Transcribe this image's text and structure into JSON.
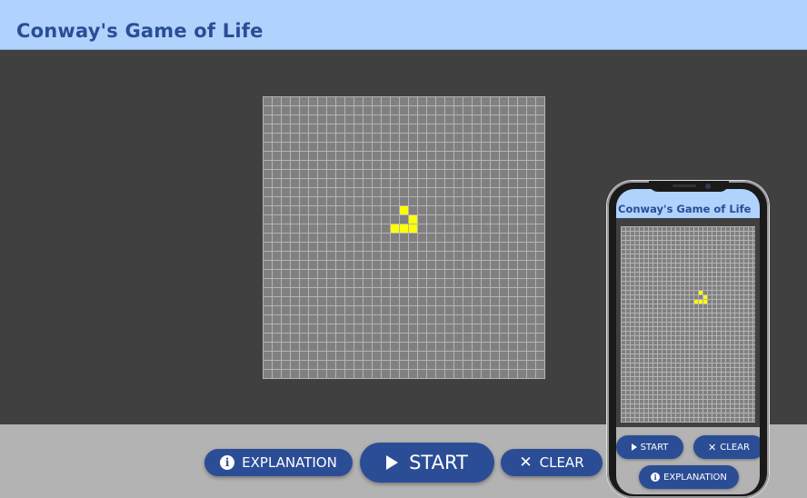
{
  "header": {
    "title": "Conway's Game of Life"
  },
  "colors": {
    "header_bg": "#b0d2fc",
    "title": "#2b4d96",
    "board_bg": "#404040",
    "grid": "#808080",
    "live_cell": "#ffff00",
    "button": "#2b4d96",
    "footer_bg": "#b3b3b3"
  },
  "board": {
    "columns": 31,
    "rows": 31,
    "live_cells": [
      [
        15,
        12
      ],
      [
        16,
        13
      ],
      [
        14,
        14
      ],
      [
        15,
        14
      ],
      [
        16,
        14
      ]
    ]
  },
  "controls": {
    "explanation_label": "EXPLANATION",
    "start_label": "START",
    "clear_label": "CLEAR",
    "icons": {
      "explanation": "info-icon",
      "start": "play-icon",
      "clear": "close-icon"
    }
  },
  "phone_preview": {
    "title": "Conway's Game of Life",
    "live_cells": [
      [
        17,
        14
      ],
      [
        18,
        15
      ],
      [
        16,
        16
      ],
      [
        17,
        16
      ],
      [
        18,
        16
      ]
    ],
    "start_label": "START",
    "clear_label": "CLEAR",
    "explanation_label": "EXPLANATION"
  }
}
